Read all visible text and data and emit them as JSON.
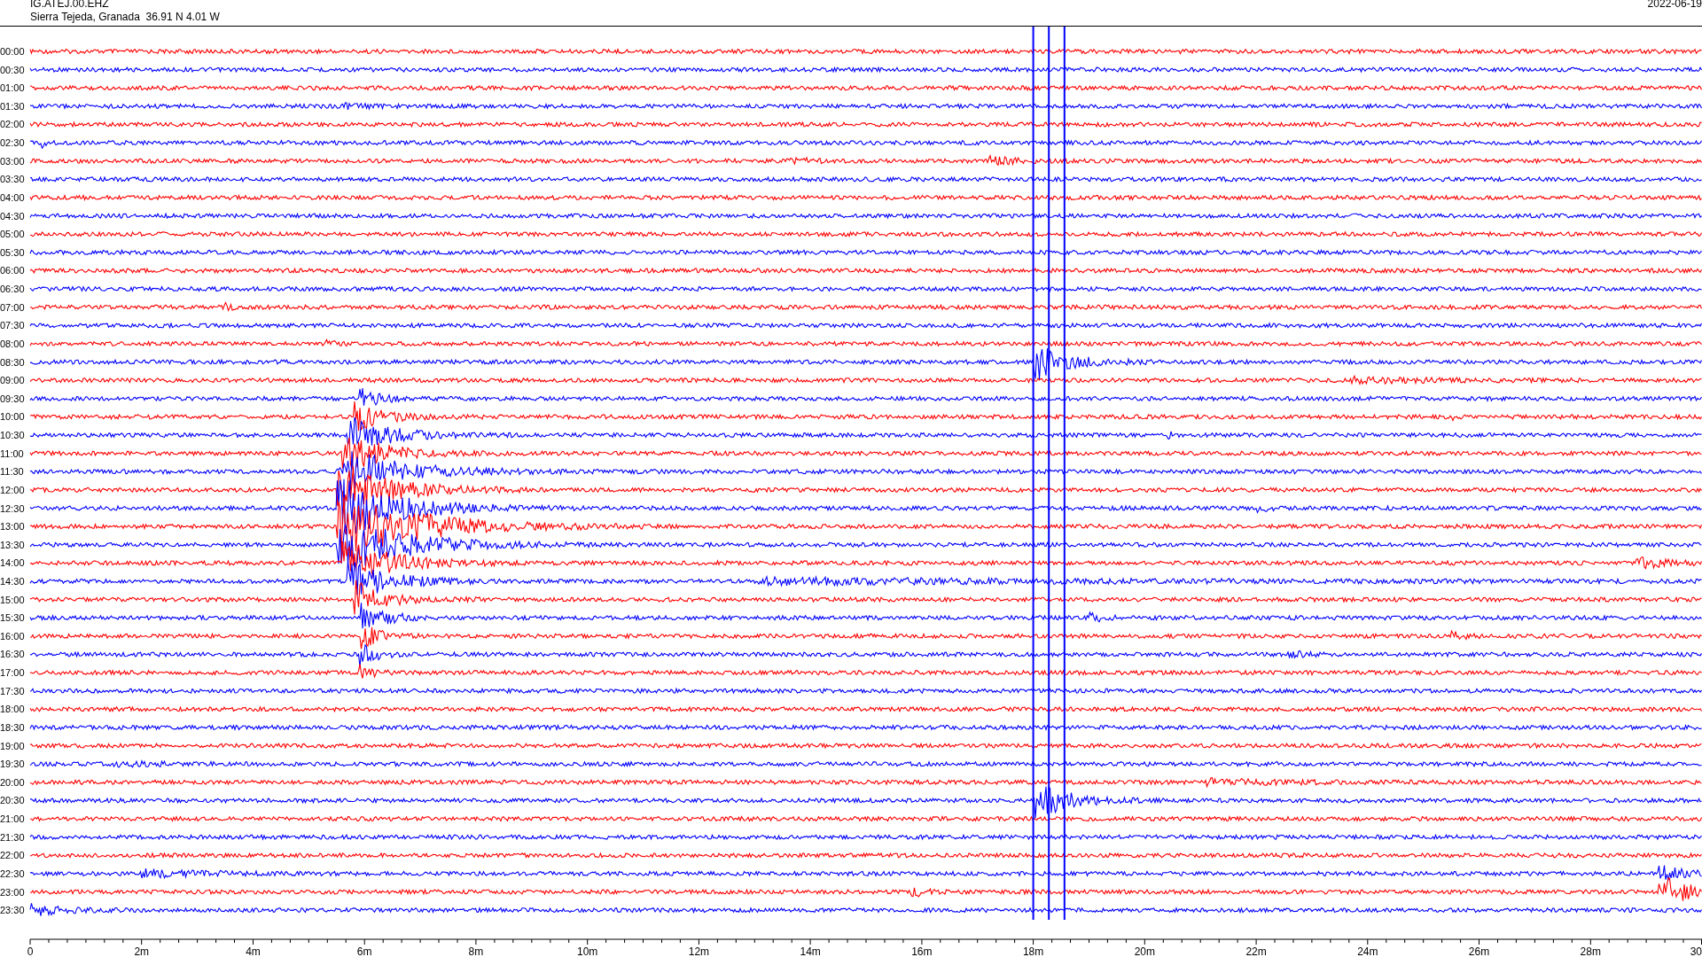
{
  "header": {
    "channel": "IG.ATEJ.00.EHZ",
    "location": "Sierra Tejeda, Granada  36.91 N 4.01 W",
    "date": "2022-06-19"
  },
  "rows": [
    {
      "label": "00:00",
      "color": "#ff0000"
    },
    {
      "label": "00:30",
      "color": "#0000ff"
    },
    {
      "label": "01:00",
      "color": "#ff0000"
    },
    {
      "label": "01:30",
      "color": "#0000ff"
    },
    {
      "label": "02:00",
      "color": "#ff0000"
    },
    {
      "label": "02:30",
      "color": "#0000ff"
    },
    {
      "label": "03:00",
      "color": "#ff0000"
    },
    {
      "label": "03:30",
      "color": "#0000ff"
    },
    {
      "label": "04:00",
      "color": "#ff0000"
    },
    {
      "label": "04:30",
      "color": "#0000ff"
    },
    {
      "label": "05:00",
      "color": "#ff0000"
    },
    {
      "label": "05:30",
      "color": "#0000ff"
    },
    {
      "label": "06:00",
      "color": "#ff0000"
    },
    {
      "label": "06:30",
      "color": "#0000ff"
    },
    {
      "label": "07:00",
      "color": "#ff0000"
    },
    {
      "label": "07:30",
      "color": "#0000ff"
    },
    {
      "label": "08:00",
      "color": "#ff0000"
    },
    {
      "label": "08:30",
      "color": "#0000ff"
    },
    {
      "label": "09:00",
      "color": "#ff0000"
    },
    {
      "label": "09:30",
      "color": "#0000ff"
    },
    {
      "label": "10:00",
      "color": "#ff0000"
    },
    {
      "label": "10:30",
      "color": "#0000ff"
    },
    {
      "label": "11:00",
      "color": "#ff0000"
    },
    {
      "label": "11:30",
      "color": "#0000ff"
    },
    {
      "label": "12:00",
      "color": "#ff0000"
    },
    {
      "label": "12:30",
      "color": "#0000ff"
    },
    {
      "label": "13:00",
      "color": "#ff0000"
    },
    {
      "label": "13:30",
      "color": "#0000ff"
    },
    {
      "label": "14:00",
      "color": "#ff0000"
    },
    {
      "label": "14:30",
      "color": "#0000ff"
    },
    {
      "label": "15:00",
      "color": "#ff0000"
    },
    {
      "label": "15:30",
      "color": "#0000ff"
    },
    {
      "label": "16:00",
      "color": "#ff0000"
    },
    {
      "label": "16:30",
      "color": "#0000ff"
    },
    {
      "label": "17:00",
      "color": "#ff0000"
    },
    {
      "label": "17:30",
      "color": "#0000ff"
    },
    {
      "label": "18:00",
      "color": "#ff0000"
    },
    {
      "label": "18:30",
      "color": "#0000ff"
    },
    {
      "label": "19:00",
      "color": "#ff0000"
    },
    {
      "label": "19:30",
      "color": "#0000ff"
    },
    {
      "label": "20:00",
      "color": "#ff0000"
    },
    {
      "label": "20:30",
      "color": "#0000ff"
    },
    {
      "label": "21:00",
      "color": "#ff0000"
    },
    {
      "label": "21:30",
      "color": "#0000ff"
    },
    {
      "label": "22:00",
      "color": "#ff0000"
    },
    {
      "label": "22:30",
      "color": "#0000ff"
    },
    {
      "label": "23:00",
      "color": "#ff0000"
    },
    {
      "label": "23:30",
      "color": "#0000ff"
    }
  ],
  "x_axis": {
    "ticks": [
      "0",
      "2m",
      "4m",
      "6m",
      "8m",
      "10m",
      "12m",
      "14m",
      "16m",
      "18m",
      "20m",
      "22m",
      "24m",
      "26m",
      "28m",
      "30"
    ]
  }
}
